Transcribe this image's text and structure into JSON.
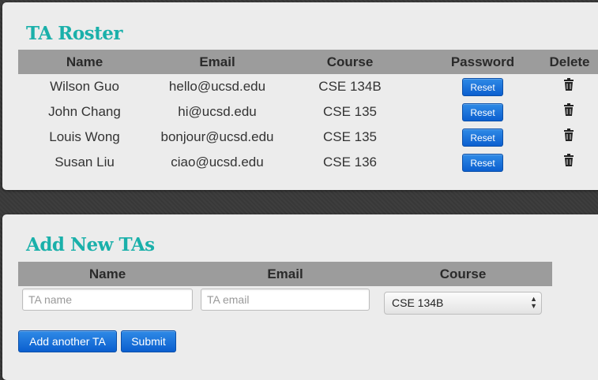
{
  "roster": {
    "title": "TA Roster",
    "headers": {
      "name": "Name",
      "email": "Email",
      "course": "Course",
      "password": "Password",
      "delete": "Delete"
    },
    "reset_label": "Reset",
    "delete_icon": "trash-icon",
    "rows": [
      {
        "name": "Wilson Guo",
        "email": "hello@ucsd.edu",
        "course": "CSE 134B"
      },
      {
        "name": "John Chang",
        "email": "hi@ucsd.edu",
        "course": "CSE 135"
      },
      {
        "name": "Louis Wong",
        "email": "bonjour@ucsd.edu",
        "course": "CSE 135"
      },
      {
        "name": "Susan Liu",
        "email": "ciao@ucsd.edu",
        "course": "CSE 136"
      }
    ]
  },
  "add": {
    "title": "Add New TAs",
    "headers": {
      "name": "Name",
      "email": "Email",
      "course": "Course"
    },
    "name_placeholder": "TA name",
    "email_placeholder": "TA email",
    "course_selected": "CSE 134B",
    "add_another_label": "Add another TA",
    "submit_label": "Submit"
  },
  "colors": {
    "title": "#1ab0aa",
    "header_bg": "#9c9c9c",
    "button": "#0b5fcf"
  }
}
